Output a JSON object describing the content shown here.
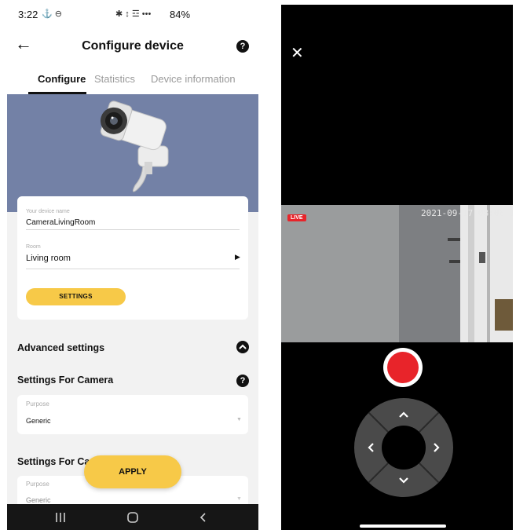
{
  "left": {
    "status": {
      "time": "3:22",
      "left_icons": "⚓ ⊖",
      "right_icons": "✱ ↕ ☲ •••",
      "battery": "84%"
    },
    "header": {
      "title": "Configure device",
      "help": "?"
    },
    "tabs": [
      {
        "label": "Configure",
        "active": true
      },
      {
        "label": "Statistics",
        "active": false
      },
      {
        "label": "Device information",
        "active": false
      }
    ],
    "device_name": {
      "label": "Your device name",
      "value": "CameraLivingRoom"
    },
    "room": {
      "label": "Room",
      "value": "Living room"
    },
    "settings_button": "SETTINGS",
    "advanced_settings": "Advanced settings",
    "camera_section_1": {
      "title": "Settings For Camera",
      "purpose_label": "Purpose",
      "purpose_value": "Generic"
    },
    "camera_section_2": {
      "title": "Settings For Cam",
      "purpose_label": "Purpose",
      "purpose_value": "Generic"
    },
    "apply_button": "APPLY",
    "colors": {
      "accent": "#f7c948",
      "hero": "#7381a6"
    }
  },
  "right": {
    "live_badge": "LIVE",
    "timestamp": "2021-09-17 08:06:15",
    "colors": {
      "record": "#e8242a",
      "dpad": "#4a4a4a"
    }
  }
}
